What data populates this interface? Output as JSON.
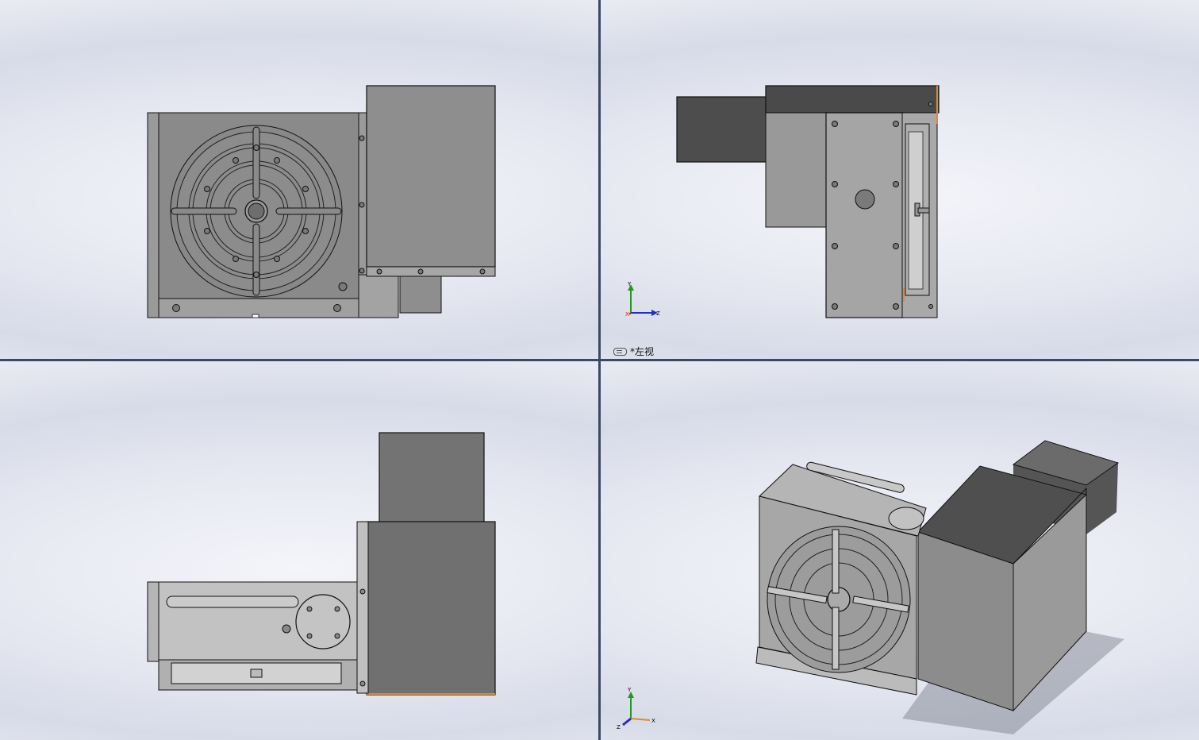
{
  "viewports": {
    "top_left": {
      "name": "front"
    },
    "top_right": {
      "name": "left",
      "label": "*左视"
    },
    "bottom_left": {
      "name": "top"
    },
    "bottom_right": {
      "name": "isometric"
    }
  },
  "triad": {
    "x": "X",
    "y": "Y",
    "z": "Z"
  },
  "colors": {
    "divider": "#3a4a66",
    "body_dark": "#6f6f6f",
    "body_mid": "#8e8e8e",
    "body_light": "#b9b9b9",
    "motor_dark": "#555555",
    "edge": "#1a1a1a",
    "highlight_orange": "#e08a2c",
    "axis_x": "#d32020",
    "axis_y": "#1f9a1f",
    "axis_z": "#1f2fbf"
  }
}
